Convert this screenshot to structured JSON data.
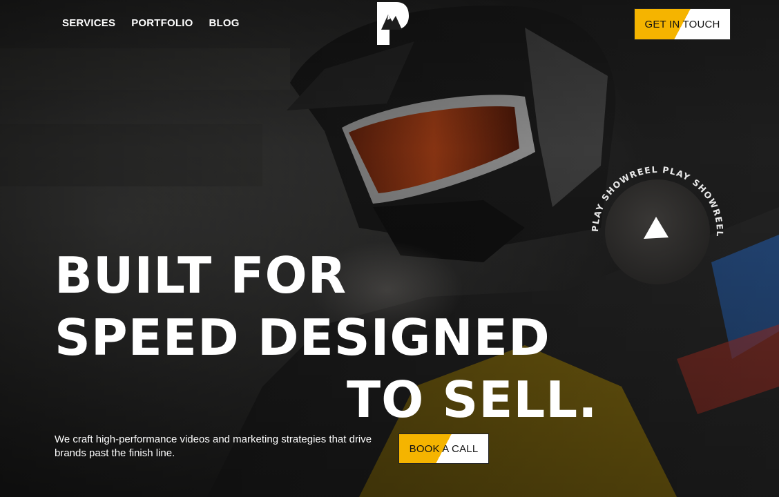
{
  "nav": {
    "items": [
      {
        "label": "SERVICES"
      },
      {
        "label": "PORTFOLIO"
      },
      {
        "label": "BLOG"
      }
    ]
  },
  "header": {
    "cta_label": "GET IN TOUCH"
  },
  "hero": {
    "headline_line1": "BUILT FOR",
    "headline_line2": "SPEED DESIGNED",
    "headline_line3": "TO SELL.",
    "subtext": "We craft high-performance videos and marketing strategies that drive brands past the finish line.",
    "cta_label": "BOOK A CALL"
  },
  "showreel": {
    "ring_text": "PLAY SHOWREEL PLAY SHOWREEL"
  },
  "colors": {
    "accent": "#f5b400",
    "text": "#ffffff"
  },
  "icons": {
    "logo": "mountain-p-logo-icon",
    "play": "play-icon"
  }
}
